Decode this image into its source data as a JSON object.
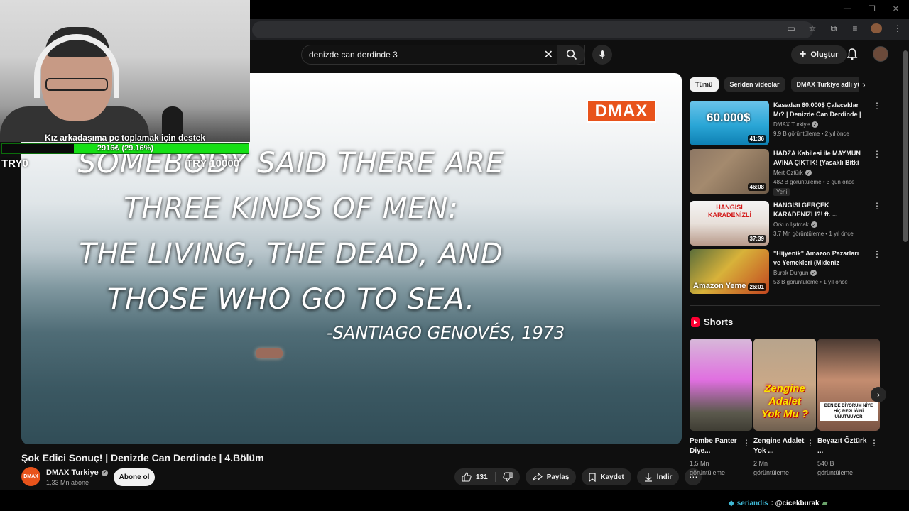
{
  "search": {
    "query": "denizde can derdinde 3"
  },
  "header": {
    "create_label": "Oluştur"
  },
  "stream_overlay": {
    "donation_title": "Kız arkadaşıma pc toplamak için destek",
    "donation_progress_text": "2916₺ (29.16%)",
    "donation_progress_fraction": 0.2916,
    "try_left": "TRY0",
    "try_right": "TRY 10000"
  },
  "video": {
    "quote_lines": [
      "SOMEBODY SAID THERE ARE",
      "THREE KINDS OF MEN:",
      "THE LIVING, THE DEAD, AND",
      "THOSE WHO GO TO SEA."
    ],
    "quote_author": "-SANTIAGO GENOVÉS, 1973",
    "logo_text": "DMAX",
    "title": "Şok Edici Sonuç! | Denizde Can Derdinde | 4.Bölüm",
    "channel": "DMAX Turkiye",
    "channel_avatar_text": "DMAX",
    "subscribers": "1,33 Mn abone",
    "subscribe_label": "Abone ol",
    "likes": "131",
    "share_label": "Paylaş",
    "save_label": "Kaydet",
    "download_label": "İndir"
  },
  "chips": [
    "Tümü",
    "Seriden videolar",
    "DMAX Turkiye adlı yükleyici"
  ],
  "recommendations": [
    {
      "title": "Kasadan 60.000$ Çalacaklar Mı? | Denizde Can Derdinde | ...",
      "channel": "DMAX Turkiye",
      "verified": true,
      "meta": "9,9 B görüntüleme • 2 yıl önce",
      "duration": "41:36",
      "thumb_caption": "60.000$",
      "new": ""
    },
    {
      "title": "HADZA Kabilesi ile MAYMUN AVINA ÇIKTIK! (Yasaklı Bitki ...",
      "channel": "Mert Öztürk",
      "verified": true,
      "meta": "482 B görüntüleme • 3 gün önce",
      "duration": "46:08",
      "thumb_caption": "",
      "new": "Yeni"
    },
    {
      "title": "HANGİSİ GERÇEK KARADENİZLİ?! ft. ...",
      "channel": "Orkun Işıtmak",
      "verified": true,
      "meta": "3,7 Mn görüntüleme • 1 yıl önce",
      "duration": "37:39",
      "thumb_caption": "HANGİSİ KARADENİZLİ",
      "new": ""
    },
    {
      "title": "\"Hijyenik\" Amazon Pazarları ve Yemekleri (Mideniz Kalkacak) ...",
      "channel": "Burak Durgun",
      "verified": true,
      "meta": "53 B görüntüleme • 1 yıl önce",
      "duration": "26:01",
      "thumb_caption": "Amazon Yeme",
      "new": ""
    }
  ],
  "shorts": {
    "heading": "Shorts",
    "items": [
      {
        "title": "Pembe Panter Diye...",
        "views": "1,5 Mn görüntüleme",
        "thumb_caption": ""
      },
      {
        "title": "Zengine Adalet Yok ...",
        "views": "2 Mn görüntüleme",
        "thumb_caption": "Zengine Adalet Yok Mu ?"
      },
      {
        "title": "Beyazıt Öztürk ...",
        "views": "540 B görüntüleme",
        "thumb_caption": "BEN DE DİYORUM NİYE HİÇ REPLİĞİNİ UNUTMUYOR"
      }
    ]
  },
  "chat": {
    "user": "seriandis",
    "message": ": @cicekburak"
  },
  "colors": {
    "accent_red": "#ff0033",
    "dmax_orange": "#e8531b",
    "progress_green": "#16e016"
  }
}
